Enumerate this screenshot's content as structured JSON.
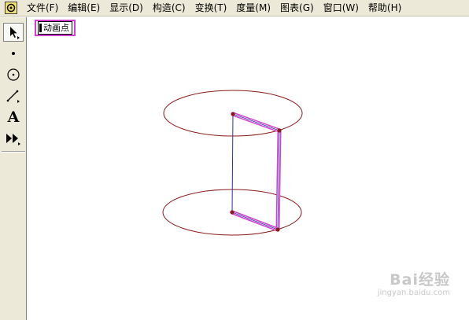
{
  "menu": {
    "items": [
      {
        "label": "文件(F)",
        "name": "menu-file"
      },
      {
        "label": "编辑(E)",
        "name": "menu-edit"
      },
      {
        "label": "显示(D)",
        "name": "menu-display"
      },
      {
        "label": "构造(C)",
        "name": "menu-construct"
      },
      {
        "label": "变换(T)",
        "name": "menu-transform"
      },
      {
        "label": "度量(M)",
        "name": "menu-measure"
      },
      {
        "label": "图表(G)",
        "name": "menu-graph"
      },
      {
        "label": "窗口(W)",
        "name": "menu-window"
      },
      {
        "label": "帮助(H)",
        "name": "menu-help"
      }
    ]
  },
  "toolbox": {
    "tools": [
      {
        "icon": "arrow-select-icon",
        "active": true
      },
      {
        "icon": "point-tool-icon",
        "active": false
      },
      {
        "icon": "compass-tool-icon",
        "active": false
      },
      {
        "icon": "straightedge-tool-icon",
        "active": false
      },
      {
        "icon": "text-tool-icon",
        "glyph": "A",
        "active": false
      },
      {
        "icon": "custom-tool-icon",
        "active": false
      }
    ]
  },
  "canvas": {
    "animate_button_label": "动画点",
    "colors": {
      "ellipse": "#8b1a1a",
      "highlight": "#d040d0",
      "segment": "#3030a0",
      "point": "#8b1a1a"
    }
  },
  "watermark": {
    "brand": "Bai经验",
    "url": "jingyan.baidu.com"
  }
}
